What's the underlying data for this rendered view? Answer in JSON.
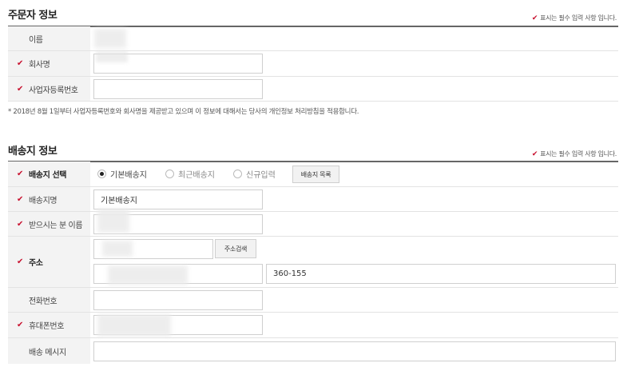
{
  "orderer": {
    "title": "주문자 정보",
    "required_note": "표시는 필수 입력 사항 입니다.",
    "fields": {
      "name_label": "이름",
      "company_label": "회사명",
      "biz_no_label": "사업자등록번호"
    },
    "notice": "* 2018년 8월 1일부터 사업자등록번호와 회사명을 제공받고 있으며 이 정보에 대해서는 당사의 개인정보 처리방침을 적용합니다."
  },
  "shipping": {
    "title": "배송지 정보",
    "required_note": "표시는 필수 입력 사항 입니다.",
    "select_label": "배송지 선택",
    "options": [
      "기본배송지",
      "최근배송지",
      "신규입력"
    ],
    "selected_option": "기본배송지",
    "list_button": "배송지 목록",
    "name_label": "배송지명",
    "name_value": "기본배송지",
    "recipient_label": "받으시는 분 이름",
    "address_label": "주소",
    "address_search_button": "주소검색",
    "address_detail_value": "360-155",
    "phone_label": "전화번호",
    "mobile_label": "휴대폰번호",
    "message_label": "배송 메시지"
  },
  "colors": {
    "required_mark": "#c8102e"
  },
  "icons": {
    "required_mark": "checkmark-icon"
  }
}
